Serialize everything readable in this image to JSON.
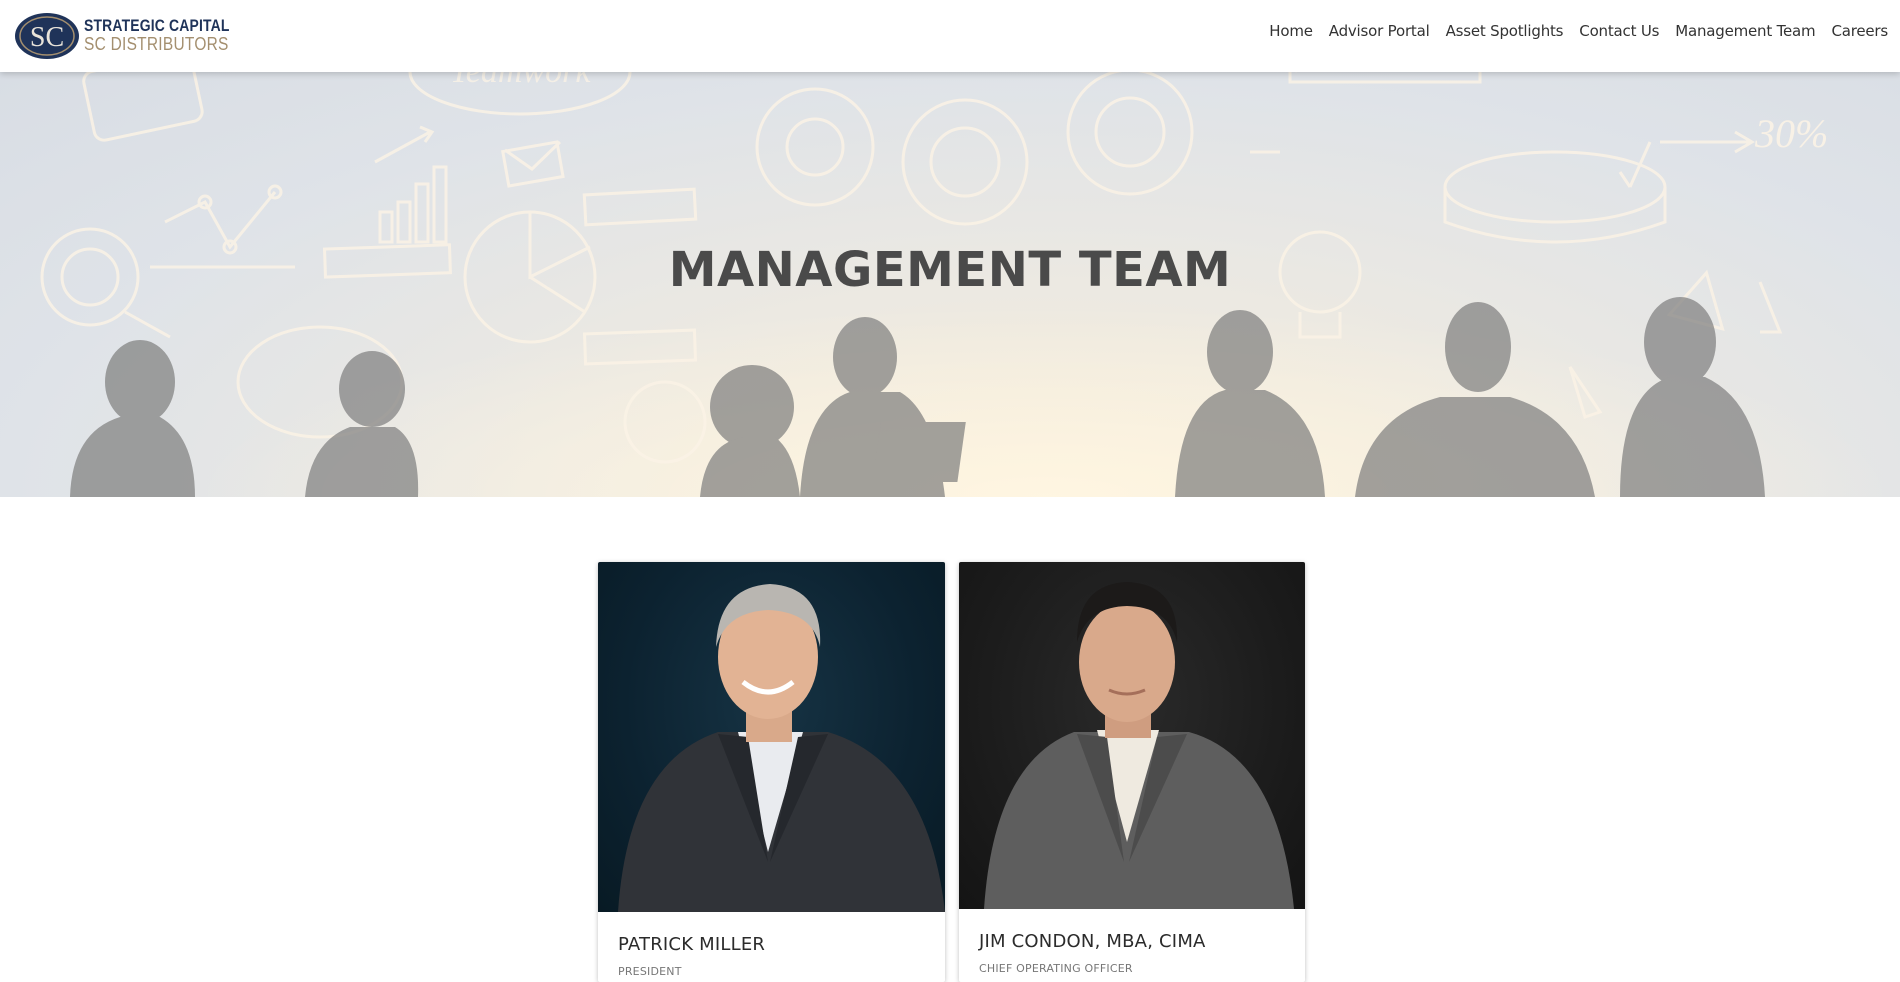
{
  "brand": {
    "logo_initials": "SC",
    "line1": "STRATEGIC CAPITAL",
    "line2": "SC DISTRIBUTORS",
    "colors": {
      "navy": "#1f3359",
      "gold": "#a48f6f"
    }
  },
  "nav": {
    "items": [
      {
        "label": "Home"
      },
      {
        "label": "Advisor Portal"
      },
      {
        "label": "Asset Spotlights"
      },
      {
        "label": "Contact Us"
      },
      {
        "label": "Management Team"
      },
      {
        "label": "Careers"
      }
    ]
  },
  "hero": {
    "title": "MANAGEMENT TEAM",
    "sketch_text": [
      "Teamwork",
      "30%"
    ]
  },
  "team": [
    {
      "name": "PATRICK MILLER",
      "title": "PRESIDENT"
    },
    {
      "name": "JIM CONDON, MBA, CIMA",
      "title": "CHIEF OPERATING OFFICER"
    }
  ]
}
